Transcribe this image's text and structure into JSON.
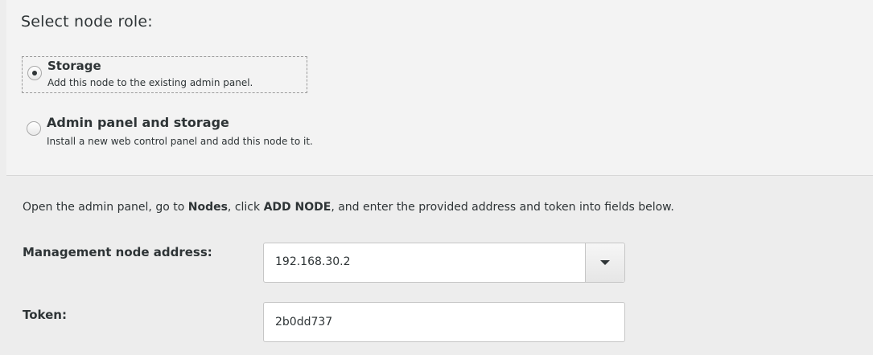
{
  "role_section": {
    "title": "Select node role:",
    "options": [
      {
        "label": "Storage",
        "description": "Add this node to the existing admin panel.",
        "selected": true
      },
      {
        "label": "Admin panel and storage",
        "description": "Install a new web control panel and add this node to it.",
        "selected": false
      }
    ]
  },
  "instruction": {
    "part1": "Open the admin panel, go to ",
    "bold1": "Nodes",
    "part2": ", click ",
    "bold2": "ADD NODE",
    "part3": ", and enter the provided address and token into fields below."
  },
  "management_address": {
    "label": "Management node address:",
    "value": "192.168.30.2",
    "button_icon": "dropdown-arrow"
  },
  "token": {
    "label": "Token:",
    "value": "2b0dd737"
  },
  "colors": {
    "background": "#ededed",
    "section_background": "#f3f3f3",
    "text": "#2e3436",
    "field_border": "#c6c6c6"
  }
}
